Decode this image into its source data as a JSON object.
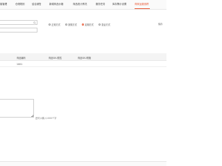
{
  "tabs": [
    {
      "label": "客管理",
      "active": false
    },
    {
      "label": "仓储规则",
      "active": false
    },
    {
      "label": "结合销售",
      "active": false
    },
    {
      "label": "新增商品价格",
      "active": false
    },
    {
      "label": "商品统计情况",
      "active": false
    },
    {
      "label": "服务任务",
      "active": false
    },
    {
      "label": "库存警示设置",
      "active": false
    },
    {
      "label": "商家运营追踪",
      "active": true
    }
  ],
  "search": {
    "placeholder": ""
  },
  "radios": [
    {
      "label": "正常方式",
      "checked": false
    },
    {
      "label": "按需方式",
      "checked": false
    },
    {
      "label": "定期方式",
      "checked": true
    },
    {
      "label": "混合方式",
      "checked": false
    }
  ],
  "right_label": "保存",
  "table": {
    "headers": [
      "商品编码",
      "商品SKU属性",
      "商品SKU规格"
    ],
    "rows": [
      [
        "1001"
      ]
    ]
  },
  "hint": "还可以输入1000个字",
  "colors": {
    "accent": "#e8532e"
  },
  "icons": {
    "search": "search-icon"
  }
}
